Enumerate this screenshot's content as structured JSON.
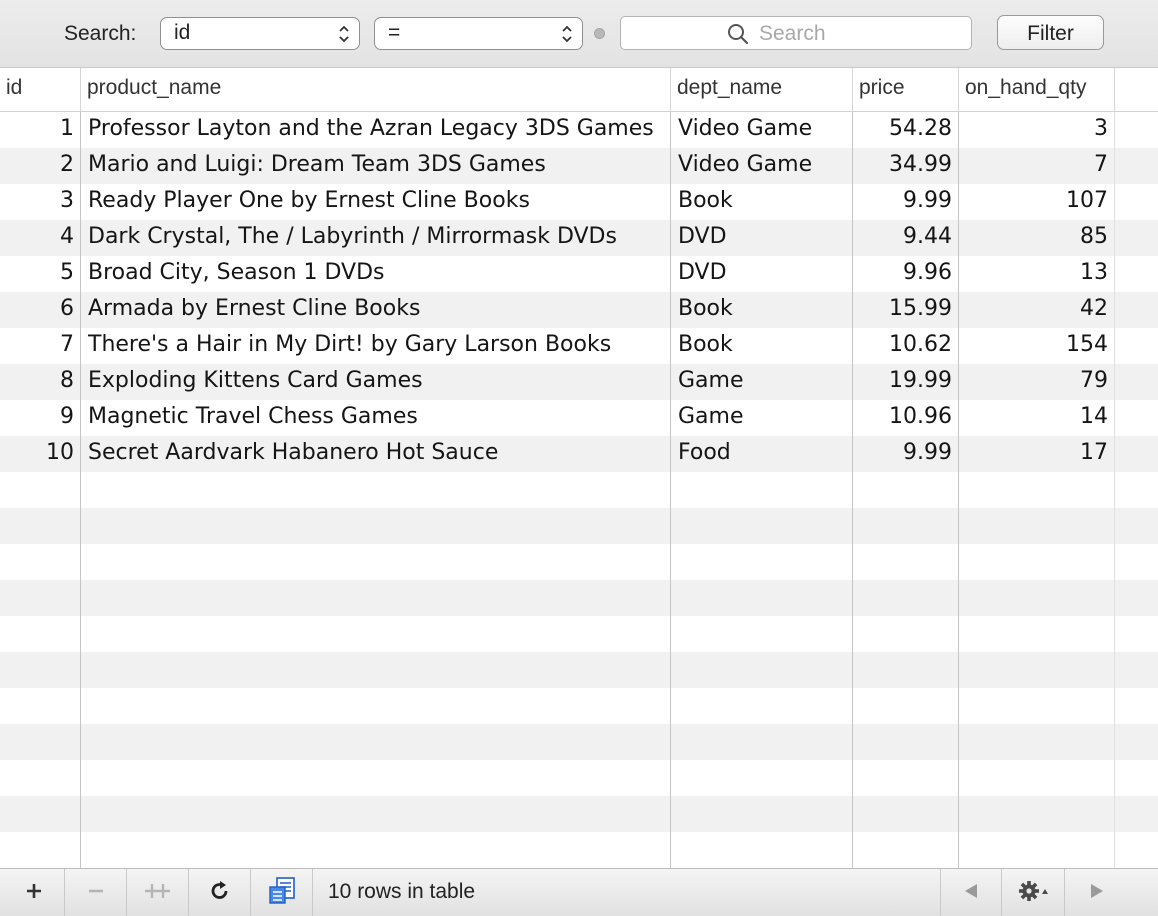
{
  "filter_bar": {
    "search_label": "Search:",
    "field_popup_value": "id",
    "operator_popup_value": "=",
    "search_placeholder": "Search",
    "search_value": "",
    "filter_button_label": "Filter"
  },
  "table": {
    "columns": [
      "id",
      "product_name",
      "dept_name",
      "price",
      "on_hand_qty"
    ],
    "rows": [
      [
        "1",
        "Professor Layton and the Azran Legacy 3DS Games",
        "Video Game",
        "54.28",
        "3"
      ],
      [
        "2",
        "Mario and Luigi: Dream Team 3DS Games",
        "Video Game",
        "34.99",
        "7"
      ],
      [
        "3",
        "Ready Player One by Ernest Cline Books",
        "Book",
        "9.99",
        "107"
      ],
      [
        "4",
        "Dark Crystal, The / Labyrinth / Mirrormask DVDs",
        "DVD",
        "9.44",
        "85"
      ],
      [
        "5",
        "Broad City, Season 1 DVDs",
        "DVD",
        "9.96",
        "13"
      ],
      [
        "6",
        "Armada by Ernest Cline Books",
        "Book",
        "15.99",
        "42"
      ],
      [
        "7",
        "There's a Hair in My Dirt! by Gary Larson Books",
        "Book",
        "10.62",
        "154"
      ],
      [
        "8",
        "Exploding Kittens Card Games",
        "Game",
        "19.99",
        "79"
      ],
      [
        "9",
        "Magnetic Travel Chess Games",
        "Game",
        "10.96",
        "14"
      ],
      [
        "10",
        "Secret Aardvark Habanero Hot Sauce",
        "Food",
        "9.99",
        "17"
      ]
    ]
  },
  "bottom_bar": {
    "icons": [
      "add-row-icon",
      "remove-row-icon",
      "duplicate-row-icon",
      "refresh-icon",
      "table-info-icon",
      "previous-page-icon",
      "gear-icon",
      "next-page-icon"
    ],
    "row_count_text": "10 rows in table"
  },
  "colors": {
    "stripe": "#f1f1f1",
    "toolbar_bg": "#e6e6e6",
    "grid_line": "#c4c4c4"
  }
}
